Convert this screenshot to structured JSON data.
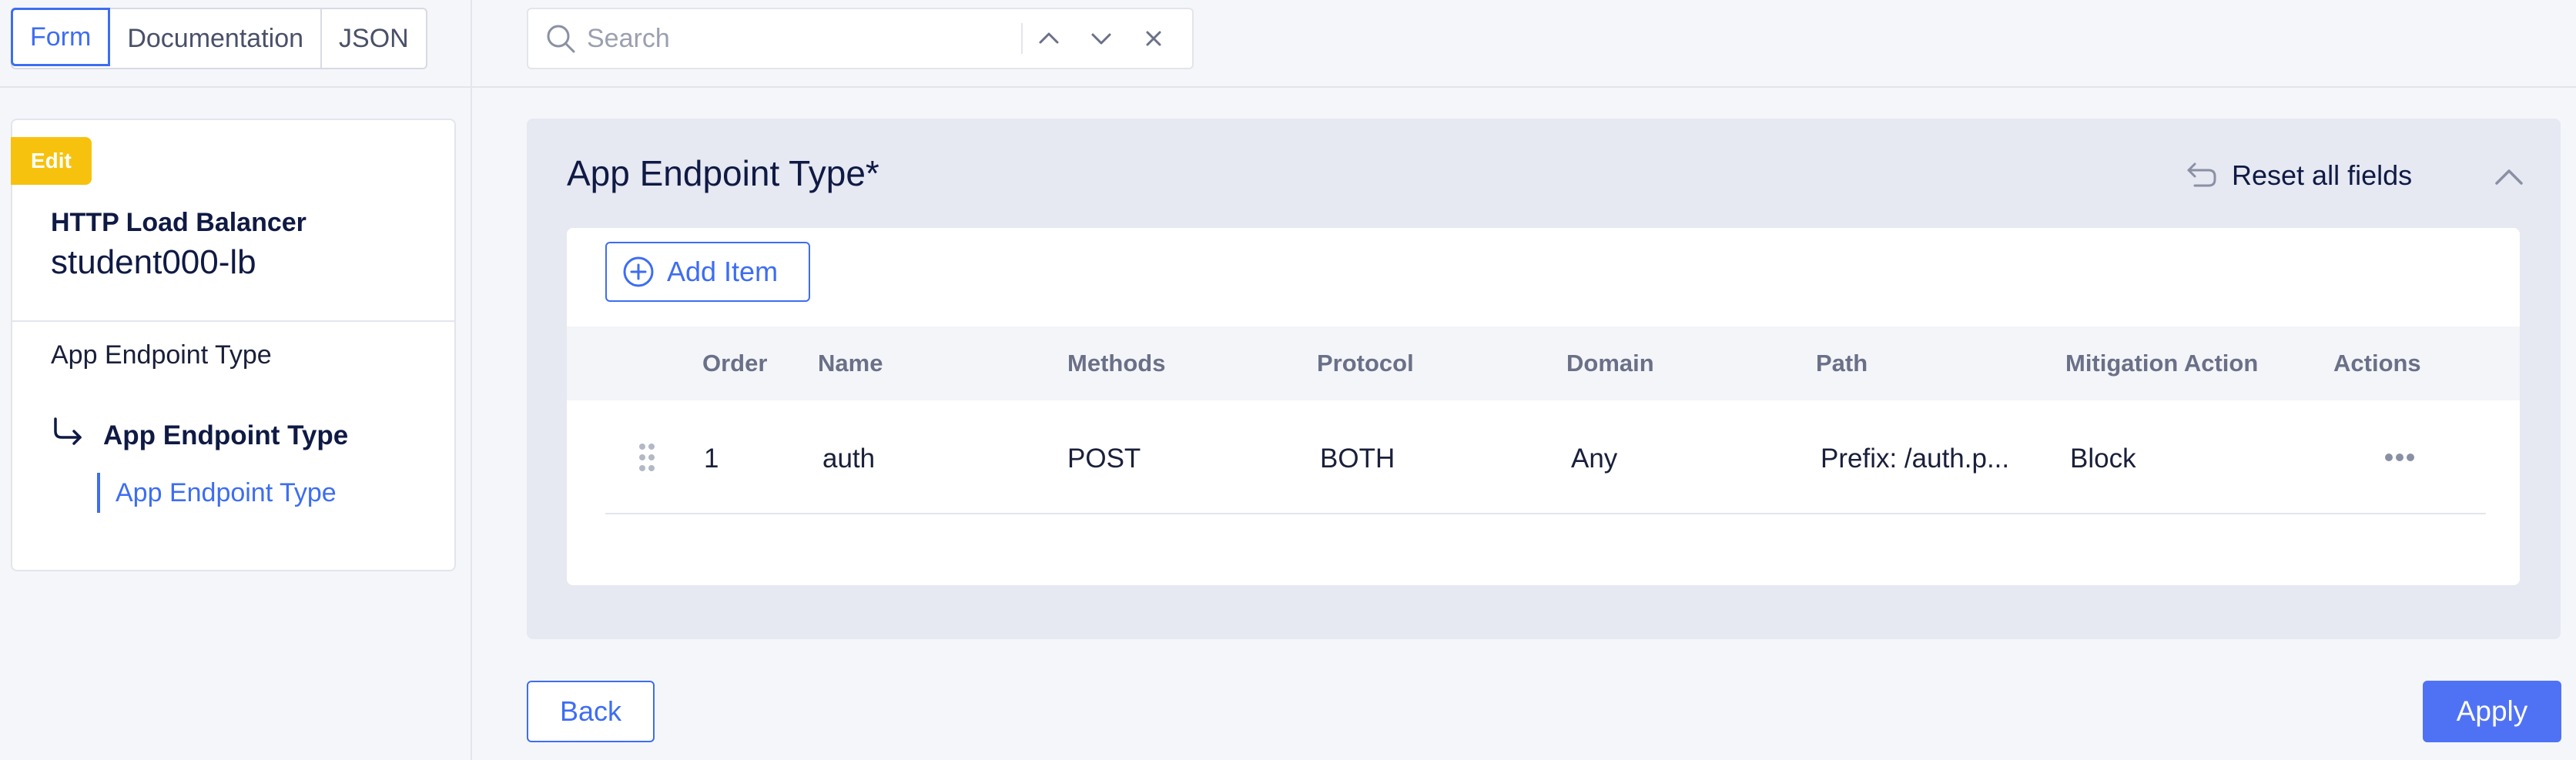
{
  "view_tabs": [
    {
      "label": "Form",
      "active": true
    },
    {
      "label": "Documentation",
      "active": false
    },
    {
      "label": "JSON",
      "active": false
    }
  ],
  "search": {
    "placeholder": "Search",
    "value": ""
  },
  "sidebar": {
    "badge": "Edit",
    "object_type": "HTTP Load Balancer",
    "object_name": "student000-lb",
    "section_label": "App Endpoint Type",
    "current_label": "App Endpoint Type",
    "sub_item_label": "App Endpoint Type"
  },
  "panel": {
    "title": "App Endpoint Type",
    "required_mark": "*",
    "reset_label": "Reset all fields",
    "add_item_label": "Add Item",
    "columns": [
      "Order",
      "Name",
      "Methods",
      "Protocol",
      "Domain",
      "Path",
      "Mitigation Action",
      "Actions"
    ],
    "rows": [
      {
        "order": "1",
        "name": "auth",
        "methods": "POST",
        "protocol": "BOTH",
        "domain": "Any",
        "path": "Prefix: /auth.p...",
        "mitigation_action": "Block"
      }
    ]
  },
  "footer": {
    "back_label": "Back",
    "apply_label": "Apply"
  },
  "colors": {
    "accent": "#3d6df2",
    "badge": "#f7c20e",
    "panel_bg": "#e6e8f2"
  }
}
